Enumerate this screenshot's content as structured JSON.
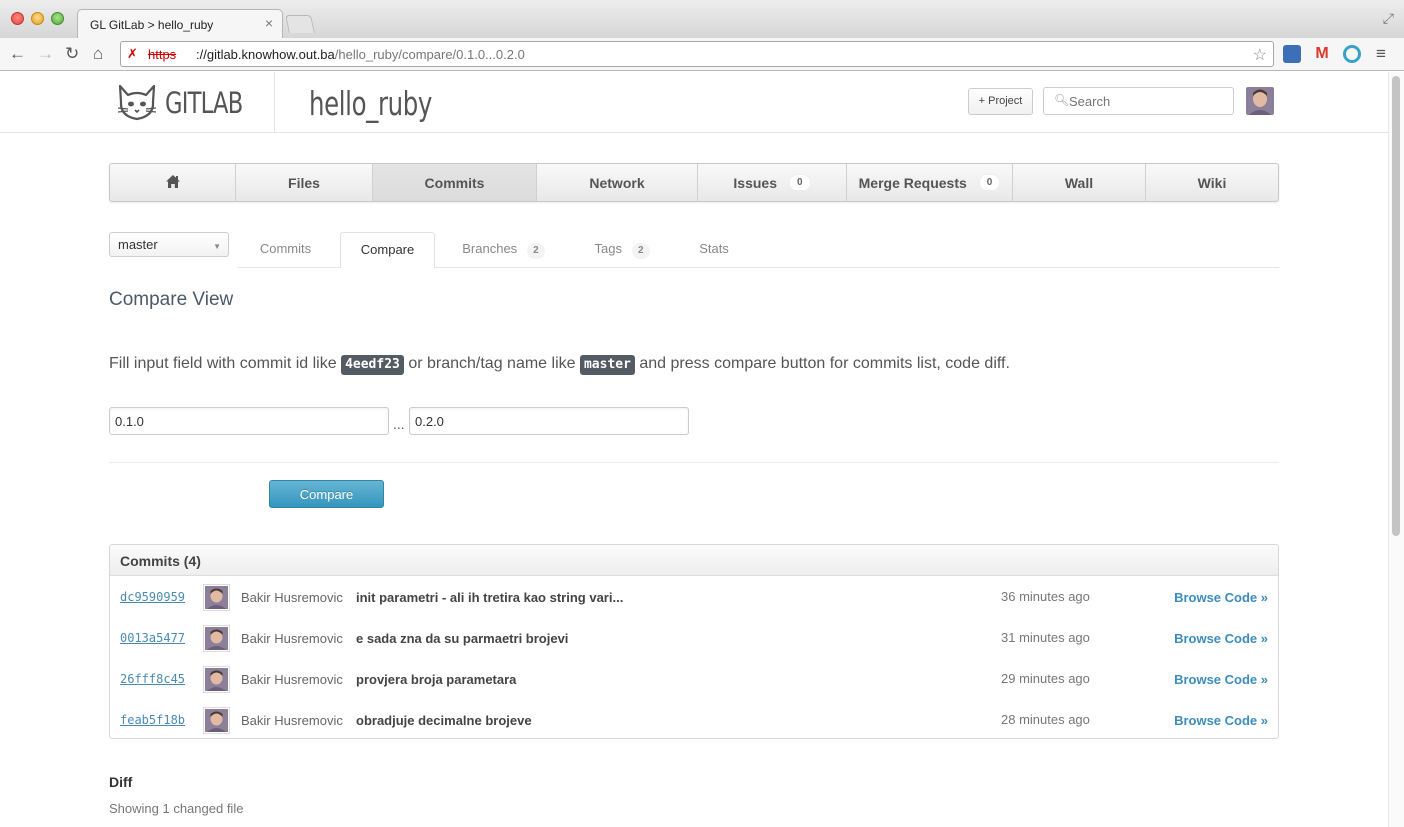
{
  "browser": {
    "tab_title": "GL GitLab > hello_ruby",
    "tab_close": "×",
    "url_scheme": "https",
    "url_host": "://gitlab.knowhow.out.ba",
    "url_path": "/hello_ruby/compare/0.1.0...0.2.0"
  },
  "header": {
    "logo_text": "GITLAB",
    "project_name": "hello_ruby",
    "new_project_label": "+ Project",
    "search_placeholder": "Search"
  },
  "nav": {
    "items": [
      {
        "label": "",
        "icon": "home-icon"
      },
      {
        "label": "Files"
      },
      {
        "label": "Commits"
      },
      {
        "label": "Network"
      },
      {
        "label": "Issues",
        "count": "0"
      },
      {
        "label": "Merge Requests",
        "count": "0"
      },
      {
        "label": "Wall"
      },
      {
        "label": "Wiki"
      }
    ],
    "active": "Commits"
  },
  "subnav": {
    "branch": "master",
    "tabs": [
      {
        "label": "Commits"
      },
      {
        "label": "Compare"
      },
      {
        "label": "Branches",
        "count": "2"
      },
      {
        "label": "Tags",
        "count": "2"
      },
      {
        "label": "Stats"
      }
    ],
    "active": "Compare"
  },
  "compare": {
    "heading": "Compare View",
    "help_part1": "Fill input field with commit id like ",
    "help_code1": "4eedf23",
    "help_part2": " or branch/tag name like ",
    "help_code2": "master",
    "help_part3": " and press compare button for commits list, code diff.",
    "from_value": "0.1.0",
    "separator": "...",
    "to_value": "0.2.0",
    "button_label": "Compare"
  },
  "commits": {
    "header": "Commits (4)",
    "rows": [
      {
        "id": "dc9590959",
        "author": "Bakir Husremovic",
        "message": "init parametri - ali ih tretira kao string vari...",
        "time": "36 minutes ago",
        "browse": "Browse Code »"
      },
      {
        "id": "0013a5477",
        "author": "Bakir Husremovic",
        "message": "e sada zna da su parmaetri brojevi",
        "time": "31 minutes ago",
        "browse": "Browse Code »"
      },
      {
        "id": "26fff8c45",
        "author": "Bakir Husremovic",
        "message": "provjera broja parametara",
        "time": "29 minutes ago",
        "browse": "Browse Code »"
      },
      {
        "id": "feab5f18b",
        "author": "Bakir Husremovic",
        "message": "obradjuje decimalne brojeve",
        "time": "28 minutes ago",
        "browse": "Browse Code »"
      }
    ]
  },
  "diff": {
    "title": "Diff",
    "summary": "Showing 1 changed file"
  },
  "colors": {
    "accent": "#3c8dbc",
    "button": "#3595be",
    "code_label_bg": "#555b63"
  }
}
